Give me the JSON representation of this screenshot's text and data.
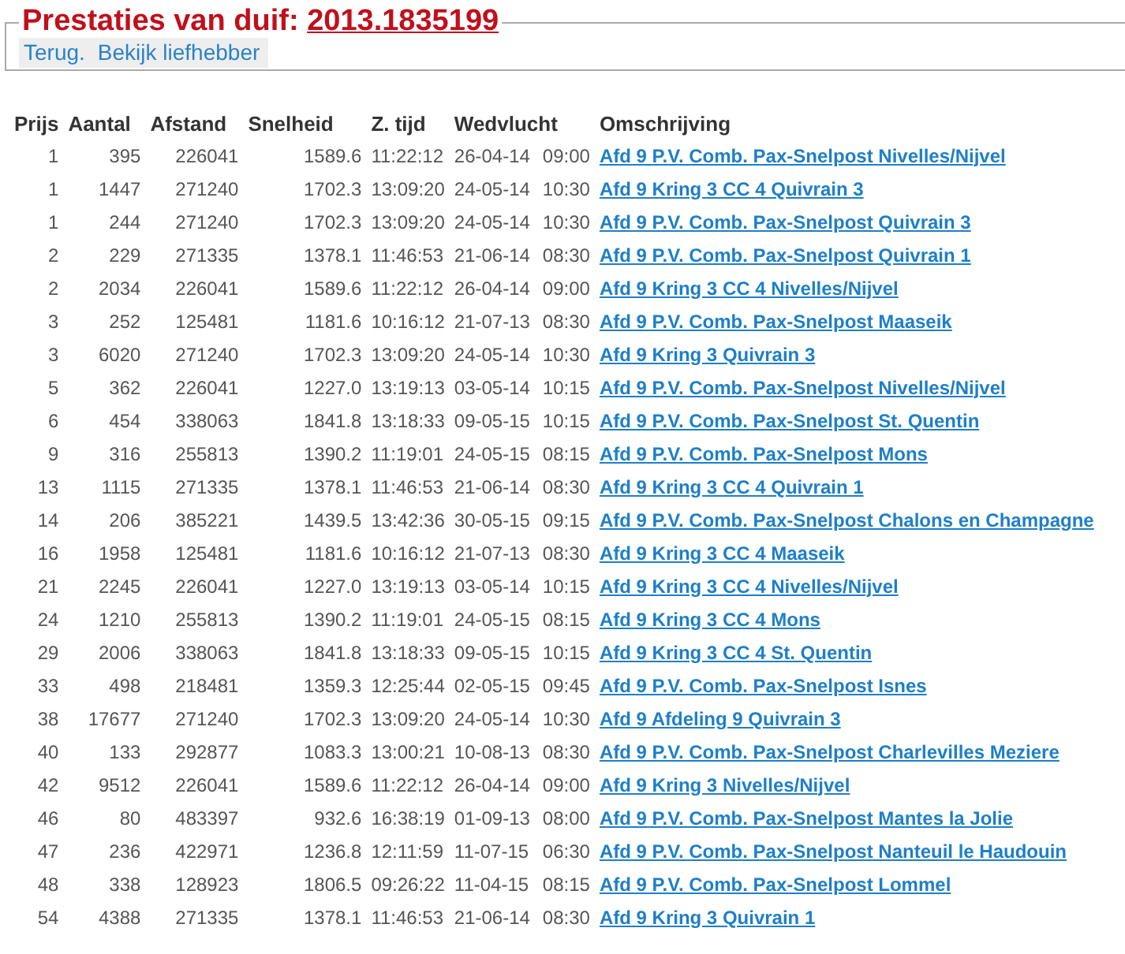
{
  "header": {
    "title": "Prestaties van duif:",
    "ring": "2013.1835199",
    "links": [
      "Terug.",
      "Bekijk liefhebber"
    ]
  },
  "table": {
    "columns": [
      "Prijs",
      "Aantal",
      "Afstand",
      "Snelheid",
      "Z. tijd",
      "Wedvlucht",
      "Omschrijving"
    ],
    "rows": [
      {
        "prijs": "1",
        "aantal": "395",
        "afstand": "226041",
        "snelheid": "1589.6",
        "tijd": "11:22:12",
        "datum": "26-04-14",
        "lossing": "09:00",
        "omschrijving": "Afd 9 P.V. Comb. Pax-Snelpost Nivelles/Nijvel"
      },
      {
        "prijs": "1",
        "aantal": "1447",
        "afstand": "271240",
        "snelheid": "1702.3",
        "tijd": "13:09:20",
        "datum": "24-05-14",
        "lossing": "10:30",
        "omschrijving": "Afd 9 Kring 3 CC 4 Quivrain 3"
      },
      {
        "prijs": "1",
        "aantal": "244",
        "afstand": "271240",
        "snelheid": "1702.3",
        "tijd": "13:09:20",
        "datum": "24-05-14",
        "lossing": "10:30",
        "omschrijving": "Afd 9 P.V. Comb. Pax-Snelpost Quivrain 3"
      },
      {
        "prijs": "2",
        "aantal": "229",
        "afstand": "271335",
        "snelheid": "1378.1",
        "tijd": "11:46:53",
        "datum": "21-06-14",
        "lossing": "08:30",
        "omschrijving": "Afd 9 P.V. Comb. Pax-Snelpost Quivrain 1"
      },
      {
        "prijs": "2",
        "aantal": "2034",
        "afstand": "226041",
        "snelheid": "1589.6",
        "tijd": "11:22:12",
        "datum": "26-04-14",
        "lossing": "09:00",
        "omschrijving": "Afd 9 Kring 3 CC 4 Nivelles/Nijvel"
      },
      {
        "prijs": "3",
        "aantal": "252",
        "afstand": "125481",
        "snelheid": "1181.6",
        "tijd": "10:16:12",
        "datum": "21-07-13",
        "lossing": "08:30",
        "omschrijving": "Afd 9 P.V. Comb. Pax-Snelpost Maaseik"
      },
      {
        "prijs": "3",
        "aantal": "6020",
        "afstand": "271240",
        "snelheid": "1702.3",
        "tijd": "13:09:20",
        "datum": "24-05-14",
        "lossing": "10:30",
        "omschrijving": "Afd 9 Kring 3 Quivrain 3"
      },
      {
        "prijs": "5",
        "aantal": "362",
        "afstand": "226041",
        "snelheid": "1227.0",
        "tijd": "13:19:13",
        "datum": "03-05-14",
        "lossing": "10:15",
        "omschrijving": "Afd 9 P.V. Comb. Pax-Snelpost Nivelles/Nijvel"
      },
      {
        "prijs": "6",
        "aantal": "454",
        "afstand": "338063",
        "snelheid": "1841.8",
        "tijd": "13:18:33",
        "datum": "09-05-15",
        "lossing": "10:15",
        "omschrijving": "Afd 9 P.V. Comb. Pax-Snelpost St. Quentin"
      },
      {
        "prijs": "9",
        "aantal": "316",
        "afstand": "255813",
        "snelheid": "1390.2",
        "tijd": "11:19:01",
        "datum": "24-05-15",
        "lossing": "08:15",
        "omschrijving": "Afd 9 P.V. Comb. Pax-Snelpost Mons"
      },
      {
        "prijs": "13",
        "aantal": "1115",
        "afstand": "271335",
        "snelheid": "1378.1",
        "tijd": "11:46:53",
        "datum": "21-06-14",
        "lossing": "08:30",
        "omschrijving": "Afd 9 Kring 3 CC 4 Quivrain 1"
      },
      {
        "prijs": "14",
        "aantal": "206",
        "afstand": "385221",
        "snelheid": "1439.5",
        "tijd": "13:42:36",
        "datum": "30-05-15",
        "lossing": "09:15",
        "omschrijving": "Afd 9 P.V. Comb. Pax-Snelpost Chalons en Champagne"
      },
      {
        "prijs": "16",
        "aantal": "1958",
        "afstand": "125481",
        "snelheid": "1181.6",
        "tijd": "10:16:12",
        "datum": "21-07-13",
        "lossing": "08:30",
        "omschrijving": "Afd 9 Kring 3 CC 4 Maaseik"
      },
      {
        "prijs": "21",
        "aantal": "2245",
        "afstand": "226041",
        "snelheid": "1227.0",
        "tijd": "13:19:13",
        "datum": "03-05-14",
        "lossing": "10:15",
        "omschrijving": "Afd 9 Kring 3 CC 4 Nivelles/Nijvel"
      },
      {
        "prijs": "24",
        "aantal": "1210",
        "afstand": "255813",
        "snelheid": "1390.2",
        "tijd": "11:19:01",
        "datum": "24-05-15",
        "lossing": "08:15",
        "omschrijving": "Afd 9 Kring 3 CC 4 Mons"
      },
      {
        "prijs": "29",
        "aantal": "2006",
        "afstand": "338063",
        "snelheid": "1841.8",
        "tijd": "13:18:33",
        "datum": "09-05-15",
        "lossing": "10:15",
        "omschrijving": "Afd 9 Kring 3 CC 4 St. Quentin"
      },
      {
        "prijs": "33",
        "aantal": "498",
        "afstand": "218481",
        "snelheid": "1359.3",
        "tijd": "12:25:44",
        "datum": "02-05-15",
        "lossing": "09:45",
        "omschrijving": "Afd 9 P.V. Comb. Pax-Snelpost Isnes"
      },
      {
        "prijs": "38",
        "aantal": "17677",
        "afstand": "271240",
        "snelheid": "1702.3",
        "tijd": "13:09:20",
        "datum": "24-05-14",
        "lossing": "10:30",
        "omschrijving": "Afd 9 Afdeling 9 Quivrain 3"
      },
      {
        "prijs": "40",
        "aantal": "133",
        "afstand": "292877",
        "snelheid": "1083.3",
        "tijd": "13:00:21",
        "datum": "10-08-13",
        "lossing": "08:30",
        "omschrijving": "Afd 9 P.V. Comb. Pax-Snelpost Charlevilles Meziere"
      },
      {
        "prijs": "42",
        "aantal": "9512",
        "afstand": "226041",
        "snelheid": "1589.6",
        "tijd": "11:22:12",
        "datum": "26-04-14",
        "lossing": "09:00",
        "omschrijving": "Afd 9 Kring 3 Nivelles/Nijvel"
      },
      {
        "prijs": "46",
        "aantal": "80",
        "afstand": "483397",
        "snelheid": "932.6",
        "tijd": "16:38:19",
        "datum": "01-09-13",
        "lossing": "08:00",
        "omschrijving": "Afd 9 P.V. Comb. Pax-Snelpost Mantes la Jolie"
      },
      {
        "prijs": "47",
        "aantal": "236",
        "afstand": "422971",
        "snelheid": "1236.8",
        "tijd": "12:11:59",
        "datum": "11-07-15",
        "lossing": "06:30",
        "omschrijving": "Afd 9 P.V. Comb. Pax-Snelpost Nanteuil le Haudouin"
      },
      {
        "prijs": "48",
        "aantal": "338",
        "afstand": "128923",
        "snelheid": "1806.5",
        "tijd": "09:26:22",
        "datum": "11-04-15",
        "lossing": "08:15",
        "omschrijving": "Afd 9 P.V. Comb. Pax-Snelpost Lommel"
      },
      {
        "prijs": "54",
        "aantal": "4388",
        "afstand": "271335",
        "snelheid": "1378.1",
        "tijd": "11:46:53",
        "datum": "21-06-14",
        "lossing": "08:30",
        "omschrijving": "Afd 9 Kring 3 Quivrain 1"
      }
    ]
  }
}
